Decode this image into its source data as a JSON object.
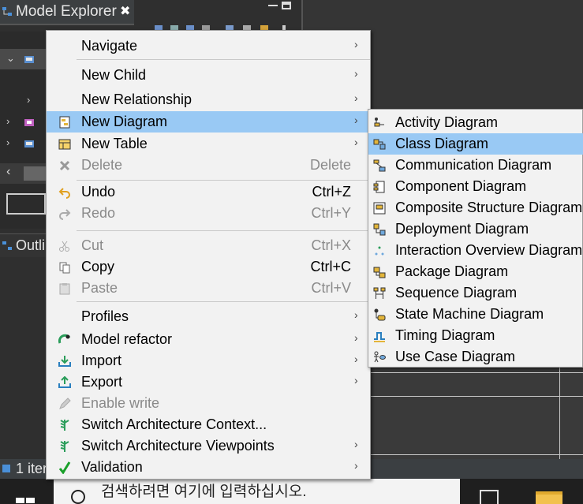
{
  "ide": {
    "view_tab_title": "Model Explorer",
    "view_tab_close": "✖",
    "outline_tab_title": "Outli",
    "status_text": "1 iter"
  },
  "context_menu": {
    "items": [
      {
        "label": "Navigate",
        "accel": "",
        "submenu_arrow": "›",
        "enabled": true,
        "icon": ""
      },
      {
        "label": "New Child",
        "accel": "",
        "submenu_arrow": "›",
        "enabled": true,
        "icon": ""
      },
      {
        "label": "New Relationship",
        "accel": "",
        "submenu_arrow": "›",
        "enabled": true,
        "icon": ""
      },
      {
        "label": "New Diagram",
        "accel": "",
        "submenu_arrow": "›",
        "enabled": true,
        "icon": "new-diagram-icon",
        "highlighted": true
      },
      {
        "label": "New Table",
        "accel": "",
        "submenu_arrow": "›",
        "enabled": true,
        "icon": "new-table-icon"
      },
      {
        "label": "Delete",
        "accel": "Delete",
        "submenu_arrow": "",
        "enabled": false,
        "icon": "delete-icon"
      },
      {
        "label": "Undo",
        "accel": "Ctrl+Z",
        "submenu_arrow": "",
        "enabled": true,
        "icon": "undo-icon"
      },
      {
        "label": "Redo",
        "accel": "Ctrl+Y",
        "submenu_arrow": "",
        "enabled": false,
        "icon": "redo-icon"
      },
      {
        "label": "Cut",
        "accel": "Ctrl+X",
        "submenu_arrow": "",
        "enabled": false,
        "icon": "cut-icon"
      },
      {
        "label": "Copy",
        "accel": "Ctrl+C",
        "submenu_arrow": "",
        "enabled": true,
        "icon": "copy-icon"
      },
      {
        "label": "Paste",
        "accel": "Ctrl+V",
        "submenu_arrow": "",
        "enabled": false,
        "icon": "paste-icon"
      },
      {
        "label": "Profiles",
        "accel": "",
        "submenu_arrow": "›",
        "enabled": true,
        "icon": ""
      },
      {
        "label": "Model refactor",
        "accel": "",
        "submenu_arrow": "›",
        "enabled": true,
        "icon": "model-refactor-icon"
      },
      {
        "label": "Import",
        "accel": "",
        "submenu_arrow": "›",
        "enabled": true,
        "icon": "import-icon"
      },
      {
        "label": "Export",
        "accel": "",
        "submenu_arrow": "›",
        "enabled": true,
        "icon": "export-icon"
      },
      {
        "label": "Enable write",
        "accel": "",
        "submenu_arrow": "",
        "enabled": false,
        "icon": "pencil-icon"
      },
      {
        "label": "Switch Architecture Context...",
        "accel": "",
        "submenu_arrow": "",
        "enabled": true,
        "icon": "architecture-context-icon"
      },
      {
        "label": "Switch Architecture Viewpoints",
        "accel": "",
        "submenu_arrow": "›",
        "enabled": true,
        "icon": "architecture-viewpoints-icon"
      },
      {
        "label": "Validation",
        "accel": "",
        "submenu_arrow": "›",
        "enabled": true,
        "icon": "checkmark-icon"
      }
    ]
  },
  "diagram_submenu": {
    "items": [
      {
        "label": "Activity Diagram",
        "icon": "activity-diagram-icon"
      },
      {
        "label": "Class Diagram",
        "icon": "class-diagram-icon",
        "highlighted": true
      },
      {
        "label": "Communication Diagram",
        "icon": "communication-diagram-icon"
      },
      {
        "label": "Component Diagram",
        "icon": "component-diagram-icon"
      },
      {
        "label": "Composite Structure Diagram",
        "icon": "composite-structure-diagram-icon"
      },
      {
        "label": "Deployment Diagram",
        "icon": "deployment-diagram-icon"
      },
      {
        "label": "Interaction Overview Diagram",
        "icon": "interaction-overview-diagram-icon"
      },
      {
        "label": "Package Diagram",
        "icon": "package-diagram-icon"
      },
      {
        "label": "Sequence Diagram",
        "icon": "sequence-diagram-icon"
      },
      {
        "label": "State Machine Diagram",
        "icon": "state-machine-diagram-icon"
      },
      {
        "label": "Timing Diagram",
        "icon": "timing-diagram-icon"
      },
      {
        "label": "Use Case Diagram",
        "icon": "use-case-diagram-icon"
      }
    ]
  },
  "taskbar": {
    "search_placeholder": "검색하려면 여기에 입력하십시오."
  },
  "colors": {
    "highlight": "#99c9f4",
    "menu_bg": "#f2f2f2",
    "disabled_text": "#8a8a8a"
  }
}
